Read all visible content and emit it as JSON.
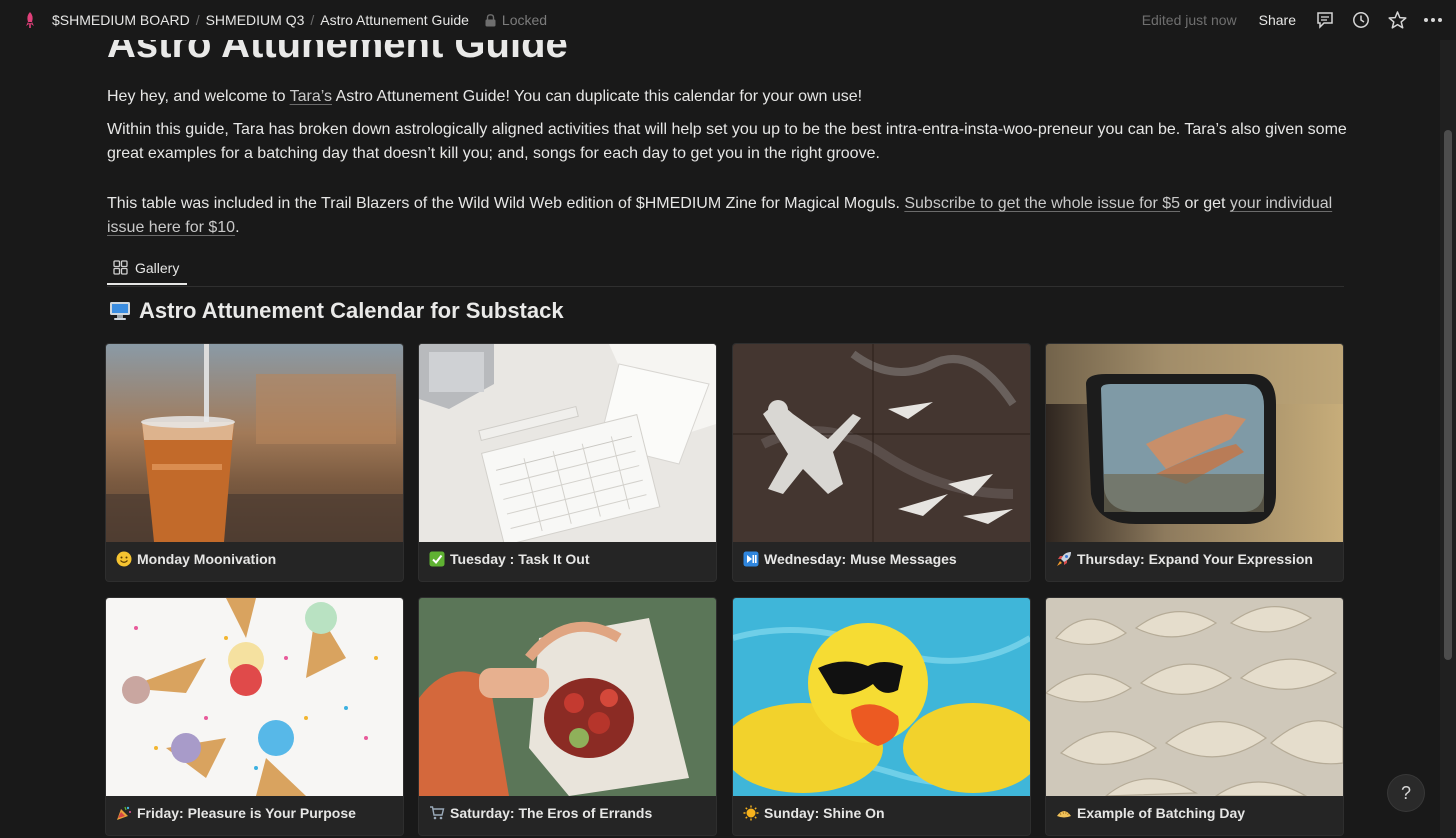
{
  "breadcrumb": {
    "items": [
      "$SHMEDIUM BOARD",
      "SHMEDIUM Q3",
      "Astro Attunement Guide"
    ],
    "locked_label": "Locked"
  },
  "topbar": {
    "edited": "Edited just now",
    "share_label": "Share"
  },
  "page": {
    "title": "Astro Attunement Guide",
    "intro": {
      "before": "Hey hey, and welcome to ",
      "link": "Tara’s",
      "after": " Astro Attunement Guide! You can duplicate this calendar for your own use!"
    },
    "body": "Within this guide, Tara has broken down astrologically aligned activities that will help set you up to be the best intra-entra-insta-woo-preneur you can be. Tara’s also given some great examples for a batching day that doesn’t kill you; and, songs for each day to get you in the right groove.",
    "note": {
      "before": "This table was included in the Trail Blazers of the Wild Wild Web edition of $HMEDIUM Zine for Magical Moguls. ",
      "link1": "Subscribe to get the whole issue for $5",
      "middle": " or get ",
      "link2": "your individual issue here for $10",
      "after": "."
    }
  },
  "view": {
    "tab_label": "Gallery"
  },
  "database": {
    "title": "Astro Attunement Calendar for Substack",
    "icon": "computer-icon",
    "cards": [
      {
        "title": "Monday Moonivation",
        "icon": "smiley-icon"
      },
      {
        "title": "Tuesday : Task It Out",
        "icon": "check-mark-icon"
      },
      {
        "title": "Wednesday: Muse Messages",
        "icon": "play-pause-icon"
      },
      {
        "title": "Thursday: Expand Your Expression",
        "icon": "rocket-icon"
      },
      {
        "title": "Friday: Pleasure is Your Purpose",
        "icon": "party-popper-icon"
      },
      {
        "title": "Saturday: The Eros of Errands",
        "icon": "shopping-cart-icon"
      },
      {
        "title": "Sunday: Shine On",
        "icon": "sun-icon"
      },
      {
        "title": "Example of Batching Day",
        "icon": "dumpling-icon"
      }
    ]
  },
  "help": {
    "label": "?"
  }
}
